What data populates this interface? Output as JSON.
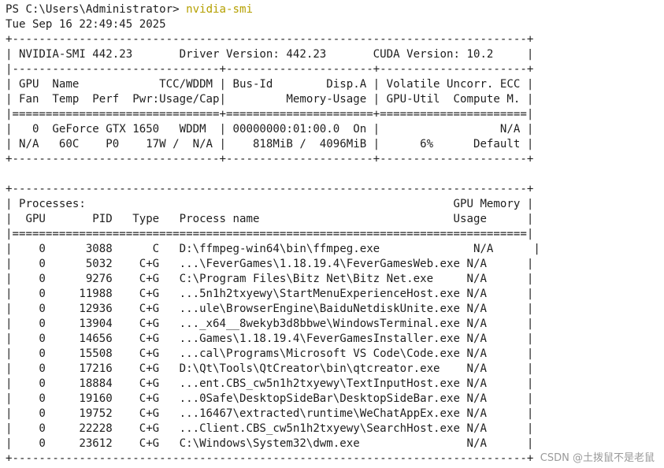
{
  "terminal": {
    "prompt": "PS C:\\Users\\Administrator> ",
    "command": "nvidia-smi",
    "timestamp": "Tue Sep 16 22:49:45 2025"
  },
  "smi": {
    "top_lines": [
      "+-----------------------------------------------------------------------------+",
      "| NVIDIA-SMI 442.23       Driver Version: 442.23       CUDA Version: 10.2     |",
      "|-------------------------------+----------------------+----------------------+",
      "| GPU  Name            TCC/WDDM | Bus-Id        Disp.A | Volatile Uncorr. ECC |",
      "| Fan  Temp  Perf  Pwr:Usage/Cap|         Memory-Usage | GPU-Util  Compute M. |",
      "|===============================+======================+======================|",
      "|   0  GeForce GTX 1650   WDDM  | 00000000:01:00.0  On |                  N/A |",
      "| N/A   60C    P0    17W /  N/A |    818MiB /  4096MiB |      6%      Default |",
      "+-------------------------------+----------------------+----------------------+",
      "",
      "+-----------------------------------------------------------------------------+",
      "| Processes:                                                       GPU Memory |",
      "|  GPU       PID   Type   Process name                             Usage      |",
      "|=============================================================================|"
    ],
    "process_rows": [
      "|    0      3088      C   D:\\ffmpeg-win64\\bin\\ffmpeg.exe              N/A      |",
      "|    0      5032    C+G   ...\\FeverGames\\1.18.19.4\\FeverGamesWeb.exe N/A      |",
      "|    0      9276    C+G   C:\\Program Files\\Bitz Net\\Bitz Net.exe     N/A      |",
      "|    0     11988    C+G   ...5n1h2txyewy\\StartMenuExperienceHost.exe N/A      |",
      "|    0     12936    C+G   ...ule\\BrowserEngine\\BaiduNetdiskUnite.exe N/A      |",
      "|    0     13904    C+G   ..._x64__8wekyb3d8bbwe\\WindowsTerminal.exe N/A      |",
      "|    0     14656    C+G   ...Games\\1.18.19.4\\FeverGamesInstaller.exe N/A      |",
      "|    0     15508    C+G   ...cal\\Programs\\Microsoft VS Code\\Code.exe N/A      |",
      "|    0     17216    C+G   D:\\Qt\\Tools\\QtCreator\\bin\\qtcreator.exe    N/A      |",
      "|    0     18884    C+G   ...ent.CBS_cw5n1h2txyewy\\TextInputHost.exe N/A      |",
      "|    0     19160    C+G   ...0Safe\\DesktopSideBar\\DesktopSideBar.exe N/A      |",
      "|    0     19752    C+G   ...16467\\extracted\\runtime\\WeChatAppEx.exe N/A      |",
      "|    0     22228    C+G   ...Client.CBS_cw5n1h2txyewy\\SearchHost.exe N/A      |",
      "|    0     23612    C+G   C:\\Windows\\System32\\dwm.exe                N/A      |"
    ],
    "bottom_line": "+-----------------------------------------------------------------------------+"
  },
  "watermark": "CSDN @土拨鼠不是老鼠"
}
